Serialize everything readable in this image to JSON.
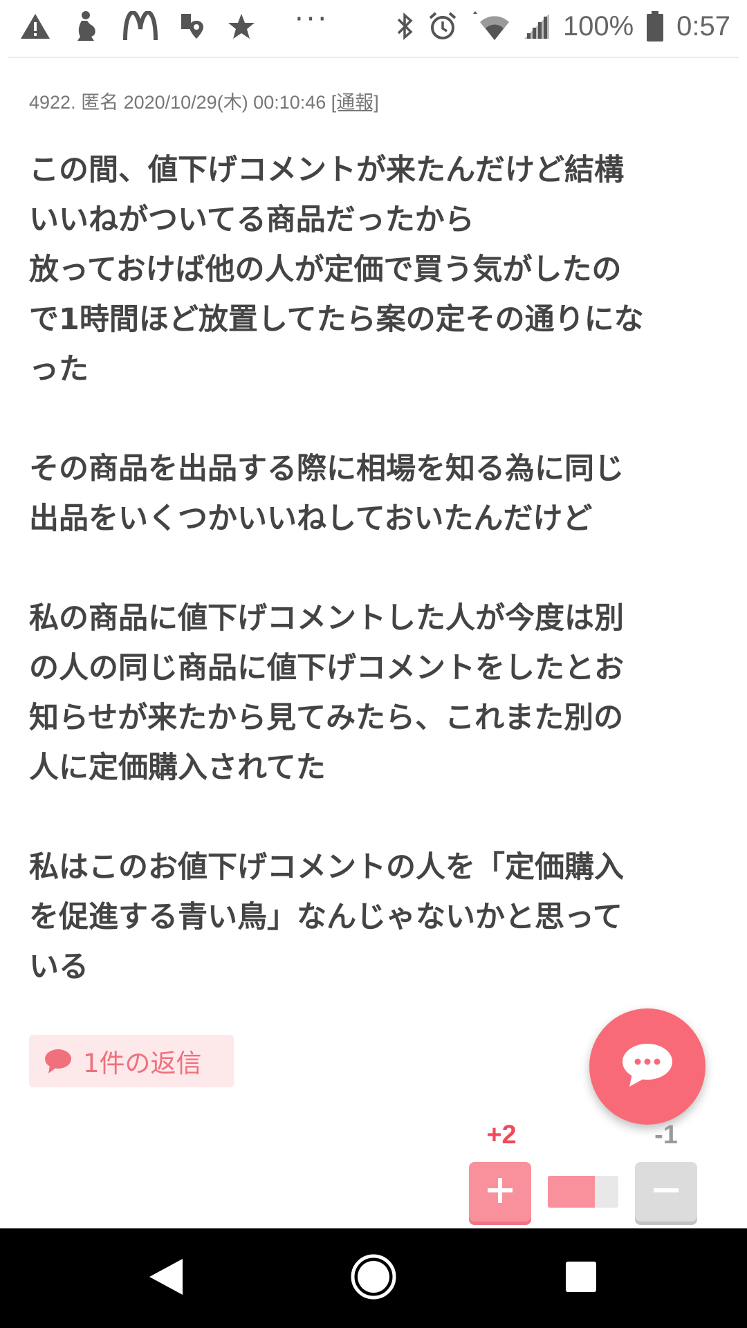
{
  "status_bar": {
    "battery_percent": "100%",
    "time": "0:57",
    "overflow_dots": "···",
    "left_icons": [
      "warning-icon",
      "pregnancy-icon",
      "mcdonalds-icon",
      "location-pin-icon",
      "star-badge-icon"
    ],
    "right_icons": [
      "bluetooth-icon",
      "alarm-icon",
      "wifi-icon",
      "cell-signal-icon",
      "battery-icon"
    ]
  },
  "post": {
    "meta": "4922. 匿名 2020/10/29(木) 00:10:46 ",
    "report_label": "[通報]",
    "paragraphs": [
      "この間、値下げコメントが来たんだけど結構\nいいねがついてる商品だったから\n放っておけば他の人が定価で買う気がしたの\nで1時間ほど放置してたら案の定その通りにな\nった",
      "その商品を出品する際に相場を知る為に同じ\n出品をいくつかいいねしておいたんだけど",
      "私の商品に値下げコメントした人が今度は別\nの人の同じ商品に値下げコメントをしたとお\n知らせが来たから見てみたら、これまた別の\n人に定価購入されてた",
      "私はこのお値下げコメントの人を「定価購入\nを促進する青い鳥」なんじゃないかと思って\nいる"
    ],
    "reply_label": "1件の返信",
    "plus_count": "+2",
    "minus_count": "-1",
    "vote_ratio": 0.67
  },
  "colors": {
    "accent": "#f96a78",
    "plus": "#f04a5a",
    "reply_bg": "#fde8ea"
  },
  "nav_bar": {
    "icons": [
      "back-icon",
      "home-icon",
      "recents-icon"
    ]
  }
}
